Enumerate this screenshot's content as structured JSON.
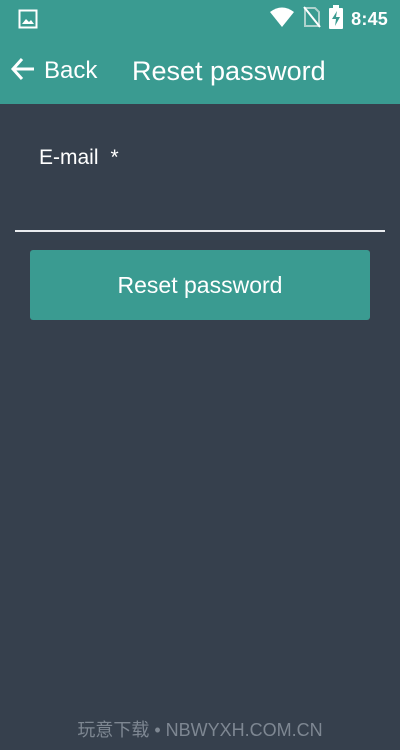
{
  "status_bar": {
    "time": "8:45",
    "icons": [
      "image-icon",
      "wifi-icon",
      "no-sim-icon",
      "battery-charging-icon"
    ]
  },
  "app_bar": {
    "back_label": "Back",
    "title": "Reset password",
    "icons": [
      "arrow-left-icon"
    ]
  },
  "form": {
    "email_label": "E-mail",
    "required_mark": "*",
    "email_value": "",
    "submit_label": "Reset password"
  },
  "watermark": "玩意下载 • NBWYXH.COM.CN",
  "colors": {
    "primary": "#3a9b91",
    "background": "#36404d",
    "text": "#ffffff",
    "watermark": "#7e8792"
  }
}
